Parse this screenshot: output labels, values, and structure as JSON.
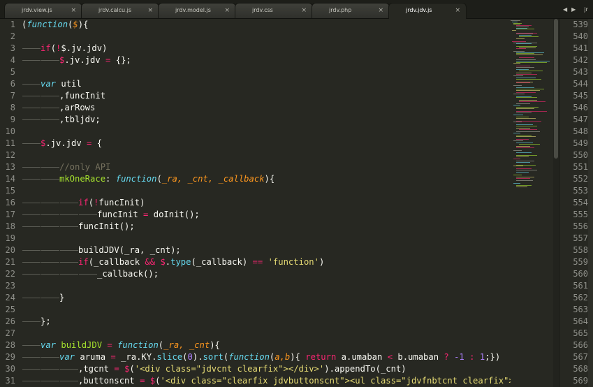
{
  "tabs": [
    {
      "label": "jrdv.view.js",
      "active": false
    },
    {
      "label": "jrdv.calcu.js",
      "active": false
    },
    {
      "label": "jrdv.model.js",
      "active": false
    },
    {
      "label": "jrdv.css",
      "active": false
    },
    {
      "label": "jrdv.php",
      "active": false
    },
    {
      "label": "jrdv.jdv.js",
      "active": true
    }
  ],
  "tab_close_glyph": "×",
  "tab_nav": {
    "prev": "◀",
    "next": "▶",
    "cut_label": "jr"
  },
  "line_numbers": [
    "1",
    "2",
    "3",
    "4",
    "5",
    "6",
    "7",
    "8",
    "9",
    "10",
    "11",
    "12",
    "13",
    "14",
    "15",
    "16",
    "17",
    "18",
    "19",
    "20",
    "21",
    "22",
    "23",
    "24",
    "25",
    "26",
    "27",
    "28",
    "29",
    "30",
    "31"
  ],
  "right_line_numbers": [
    "539",
    "540",
    "541",
    "542",
    "543",
    "544",
    "545",
    "546",
    "547",
    "548",
    "549",
    "550",
    "551",
    "552",
    "553",
    "554",
    "555",
    "556",
    "557",
    "558",
    "559",
    "560",
    "561",
    "562",
    "563",
    "564",
    "565",
    "566",
    "567",
    "568",
    "569"
  ],
  "colors": {
    "background": "#272822",
    "keyword": "#66d9ef",
    "operator": "#f92672",
    "function": "#a6e22e",
    "parameter": "#fd971f",
    "string": "#e6db74",
    "number": "#ae81ff",
    "comment": "#75715e",
    "text": "#f8f8f2"
  },
  "code_lines": [
    {
      "indent": 0,
      "tokens": [
        [
          "(",
          "pl"
        ],
        [
          "function",
          "kw"
        ],
        [
          "(",
          "pl"
        ],
        [
          "$",
          "pa"
        ],
        [
          "){",
          "pl"
        ]
      ]
    },
    {
      "indent": 0,
      "tokens": []
    },
    {
      "indent": 1,
      "tokens": [
        [
          "if",
          "op"
        ],
        [
          "(",
          "pl"
        ],
        [
          "!",
          "op"
        ],
        [
          "$.jv.jdv)",
          "pl"
        ]
      ]
    },
    {
      "indent": 2,
      "tokens": [
        [
          "$",
          "op"
        ],
        [
          ".jv.jdv ",
          "pl"
        ],
        [
          "=",
          "op"
        ],
        [
          " {};",
          "pl"
        ]
      ]
    },
    {
      "indent": 0,
      "tokens": []
    },
    {
      "indent": 1,
      "tokens": [
        [
          "var",
          "kw"
        ],
        [
          " util",
          "pl"
        ]
      ]
    },
    {
      "indent": 2,
      "tokens": [
        [
          ",funcInit",
          "pl"
        ]
      ]
    },
    {
      "indent": 2,
      "tokens": [
        [
          ",arRows",
          "pl"
        ]
      ]
    },
    {
      "indent": 2,
      "tokens": [
        [
          ",tbljdv;",
          "pl"
        ]
      ]
    },
    {
      "indent": 0,
      "tokens": []
    },
    {
      "indent": 1,
      "tokens": [
        [
          "$",
          "op"
        ],
        [
          ".jv.jdv ",
          "pl"
        ],
        [
          "=",
          "op"
        ],
        [
          " {",
          "pl"
        ]
      ]
    },
    {
      "indent": 0,
      "tokens": []
    },
    {
      "indent": 2,
      "tokens": [
        [
          "//only API",
          "cm"
        ]
      ]
    },
    {
      "indent": 2,
      "tokens": [
        [
          "mkOneRace",
          "fn"
        ],
        [
          ": ",
          "pl"
        ],
        [
          "function",
          "kw"
        ],
        [
          "(",
          "pl"
        ],
        [
          "_ra, _cnt, _callback",
          "pa"
        ],
        [
          "){",
          "pl"
        ]
      ]
    },
    {
      "indent": 0,
      "tokens": []
    },
    {
      "indent": 3,
      "tokens": [
        [
          "if",
          "op"
        ],
        [
          "(",
          "pl"
        ],
        [
          "!",
          "op"
        ],
        [
          "funcInit)",
          "pl"
        ]
      ]
    },
    {
      "indent": 4,
      "tokens": [
        [
          "funcInit ",
          "pl"
        ],
        [
          "=",
          "op"
        ],
        [
          " doInit();",
          "pl"
        ]
      ]
    },
    {
      "indent": 3,
      "tokens": [
        [
          "funcInit();",
          "pl"
        ]
      ]
    },
    {
      "indent": 0,
      "tokens": []
    },
    {
      "indent": 3,
      "tokens": [
        [
          "buildJDV(_ra, _cnt);",
          "pl"
        ]
      ]
    },
    {
      "indent": 3,
      "tokens": [
        [
          "if",
          "op"
        ],
        [
          "(_callback ",
          "pl"
        ],
        [
          "&&",
          "op"
        ],
        [
          " ",
          "pl"
        ],
        [
          "$",
          "op"
        ],
        [
          ".",
          "pl"
        ],
        [
          "type",
          "ca"
        ],
        [
          "(_callback) ",
          "pl"
        ],
        [
          "==",
          "op"
        ],
        [
          " ",
          "pl"
        ],
        [
          "'function'",
          "st"
        ],
        [
          ")",
          "pl"
        ]
      ]
    },
    {
      "indent": 4,
      "tokens": [
        [
          "_callback();",
          "pl"
        ]
      ]
    },
    {
      "indent": 0,
      "tokens": []
    },
    {
      "indent": 2,
      "tokens": [
        [
          "}",
          "pl"
        ]
      ]
    },
    {
      "indent": 0,
      "tokens": []
    },
    {
      "indent": 1,
      "tokens": [
        [
          "};",
          "pl"
        ]
      ]
    },
    {
      "indent": 0,
      "tokens": []
    },
    {
      "indent": 1,
      "tokens": [
        [
          "var",
          "kw"
        ],
        [
          " ",
          "pl"
        ],
        [
          "buildJDV",
          "fn"
        ],
        [
          " ",
          "pl"
        ],
        [
          "=",
          "op"
        ],
        [
          " ",
          "pl"
        ],
        [
          "function",
          "kw"
        ],
        [
          "(",
          "pl"
        ],
        [
          "_ra, _cnt",
          "pa"
        ],
        [
          "){",
          "pl"
        ]
      ]
    },
    {
      "indent": 2,
      "tokens": [
        [
          "var",
          "kw"
        ],
        [
          " aruma ",
          "pl"
        ],
        [
          "=",
          "op"
        ],
        [
          " _ra.KY.",
          "pl"
        ],
        [
          "slice",
          "ca"
        ],
        [
          "(",
          "pl"
        ],
        [
          "0",
          "nu"
        ],
        [
          ").",
          "pl"
        ],
        [
          "sort",
          "ca"
        ],
        [
          "(",
          "pl"
        ],
        [
          "function",
          "kw"
        ],
        [
          "(",
          "pl"
        ],
        [
          "a,b",
          "pa"
        ],
        [
          "){ ",
          "pl"
        ],
        [
          "return",
          "op"
        ],
        [
          " a.umaban ",
          "pl"
        ],
        [
          "<",
          "op"
        ],
        [
          " b.umaban ",
          "pl"
        ],
        [
          "?",
          "op"
        ],
        [
          " ",
          "pl"
        ],
        [
          "-1",
          "nu"
        ],
        [
          " ",
          "pl"
        ],
        [
          ":",
          "op"
        ],
        [
          " ",
          "pl"
        ],
        [
          "1",
          "nu"
        ],
        [
          ";})",
          "pl"
        ]
      ]
    },
    {
      "indent": 3,
      "tokens": [
        [
          ",tgcnt ",
          "pl"
        ],
        [
          "=",
          "op"
        ],
        [
          " ",
          "pl"
        ],
        [
          "$",
          "op"
        ],
        [
          "(",
          "pl"
        ],
        [
          "'<div class=\"jdvcnt clearfix\"></div>'",
          "st"
        ],
        [
          ").appendTo(_cnt)",
          "pl"
        ]
      ]
    },
    {
      "indent": 3,
      "tokens": [
        [
          ",buttonscnt ",
          "pl"
        ],
        [
          "=",
          "op"
        ],
        [
          " ",
          "pl"
        ],
        [
          "$",
          "op"
        ],
        [
          "(",
          "pl"
        ],
        [
          "'<div class=\"clearfix jdvbuttonscnt\"><ul class=\"jdvfnbtcnt clearfix\"></ul><",
          "st"
        ]
      ]
    }
  ],
  "minimap_lines": [
    [
      0,
      1,
      14
    ],
    [
      1,
      3,
      8
    ],
    [
      2,
      5,
      12
    ],
    [
      3,
      5,
      10
    ],
    [
      4,
      9,
      22
    ],
    [
      5,
      9,
      18
    ],
    [
      6,
      9,
      16
    ],
    [
      7,
      9,
      26
    ],
    [
      8,
      3,
      6
    ],
    [
      10,
      9,
      30
    ],
    [
      11,
      9,
      24
    ],
    [
      12,
      13,
      18
    ],
    [
      13,
      13,
      28
    ],
    [
      15,
      9,
      12
    ],
    [
      17,
      3,
      20
    ],
    [
      18,
      5,
      34
    ],
    [
      19,
      9,
      22
    ],
    [
      21,
      9,
      30
    ],
    [
      22,
      13,
      24
    ],
    [
      23,
      9,
      14
    ],
    [
      25,
      5,
      16
    ],
    [
      26,
      9,
      40
    ],
    [
      27,
      9,
      26
    ],
    [
      28,
      9,
      38
    ],
    [
      30,
      13,
      22
    ],
    [
      32,
      9,
      28
    ],
    [
      33,
      9,
      48
    ],
    [
      34,
      9,
      44
    ],
    [
      35,
      5,
      10
    ],
    [
      37,
      9,
      20
    ],
    [
      38,
      9,
      26
    ],
    [
      40,
      9,
      18
    ],
    [
      41,
      13,
      34
    ],
    [
      43,
      9,
      22
    ],
    [
      44,
      9,
      30
    ],
    [
      45,
      5,
      14
    ],
    [
      47,
      9,
      28
    ],
    [
      48,
      9,
      36
    ],
    [
      50,
      9,
      24
    ],
    [
      51,
      9,
      20
    ],
    [
      53,
      5,
      12
    ],
    [
      55,
      9,
      26
    ],
    [
      56,
      9,
      40
    ],
    [
      57,
      9,
      34
    ],
    [
      59,
      9,
      28
    ],
    [
      60,
      5,
      16
    ],
    [
      62,
      9,
      22
    ],
    [
      63,
      9,
      30
    ],
    [
      65,
      13,
      26
    ],
    [
      66,
      13,
      38
    ],
    [
      68,
      9,
      20
    ],
    [
      69,
      5,
      10
    ],
    [
      71,
      9,
      32
    ],
    [
      72,
      9,
      26
    ],
    [
      74,
      9,
      44
    ],
    [
      75,
      9,
      22
    ],
    [
      77,
      5,
      14
    ],
    [
      79,
      9,
      18
    ],
    [
      80,
      9,
      28
    ],
    [
      82,
      9,
      36
    ],
    [
      83,
      5,
      12
    ],
    [
      85,
      9,
      24
    ],
    [
      86,
      9,
      30
    ],
    [
      88,
      9,
      20
    ],
    [
      89,
      13,
      26
    ],
    [
      91,
      9,
      34
    ],
    [
      92,
      5,
      10
    ],
    [
      94,
      9,
      22
    ],
    [
      95,
      9,
      28
    ],
    [
      97,
      9,
      18
    ],
    [
      98,
      5,
      14
    ],
    [
      100,
      9,
      24
    ],
    [
      101,
      13,
      30
    ],
    [
      103,
      9,
      20
    ],
    [
      104,
      9,
      26
    ],
    [
      106,
      5,
      12
    ],
    [
      108,
      9,
      22
    ],
    [
      110,
      9,
      30
    ],
    [
      111,
      9,
      18
    ],
    [
      113,
      5,
      10
    ],
    [
      115,
      9,
      26
    ],
    [
      116,
      9,
      20
    ],
    [
      118,
      9,
      28
    ],
    [
      119,
      5,
      14
    ],
    [
      121,
      9,
      22
    ],
    [
      122,
      9,
      30
    ],
    [
      124,
      9,
      18
    ],
    [
      126,
      5,
      12
    ],
    [
      128,
      9,
      26
    ],
    [
      129,
      9,
      20
    ],
    [
      131,
      9,
      24
    ],
    [
      133,
      5,
      10
    ],
    [
      135,
      9,
      22
    ],
    [
      136,
      9,
      16
    ]
  ]
}
